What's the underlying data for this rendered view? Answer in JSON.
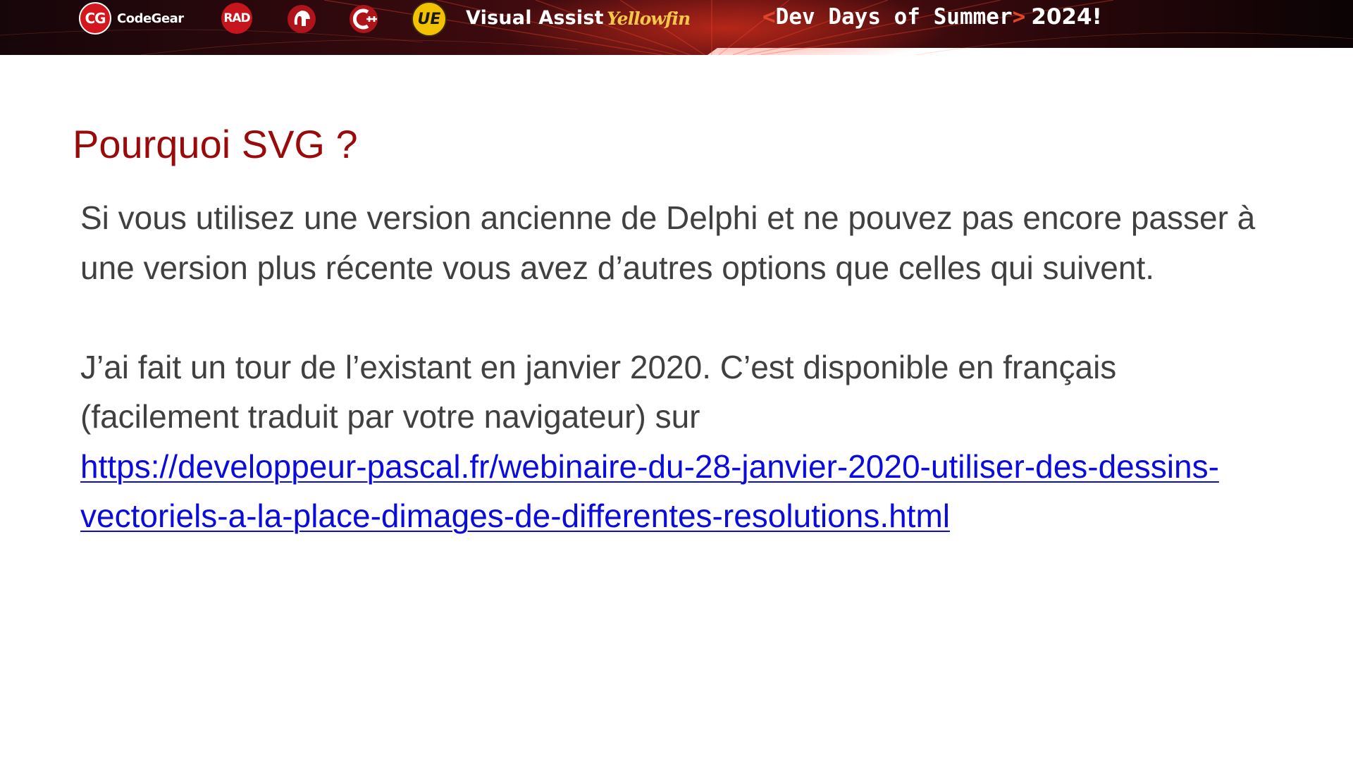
{
  "banner": {
    "logos": {
      "codegear_badge": "CG",
      "codegear": "CodeGear",
      "rad": "RAD",
      "cpp": "C++",
      "ue": "UE",
      "visual_assist": "Visual Assist",
      "yellowfin": "Yellowfin"
    },
    "event": {
      "open": "<",
      "name": "Dev Days of Summer",
      "close": ">",
      "year": "2024!"
    },
    "colors": {
      "background": "#1a0608",
      "accent": "#e0452c"
    }
  },
  "slide": {
    "title": "Pourquoi SVG ?",
    "paragraph1": "Si vous utilisez une version ancienne de Delphi et ne pouvez pas encore passer à une version plus récente vous avez d’autres options que celles qui suivent.",
    "paragraph2": "J’ai fait un tour de l’existant en janvier 2020. C’est disponible en français (facilement traduit par votre navigateur) sur",
    "link_text": "https://developpeur-pascal.fr/webinaire-du-28-janvier-2020-utiliser-des-dessins-vectoriels-a-la-place-dimages-de-differentes-resolutions.html",
    "link_href": "https://developpeur-pascal.fr/webinaire-du-28-janvier-2020-utiliser-des-dessins-vectoriels-a-la-place-dimages-de-differentes-resolutions.html",
    "colors": {
      "title": "#9b0a0a",
      "body_text": "#404040",
      "link": "#0b0bdc"
    }
  }
}
